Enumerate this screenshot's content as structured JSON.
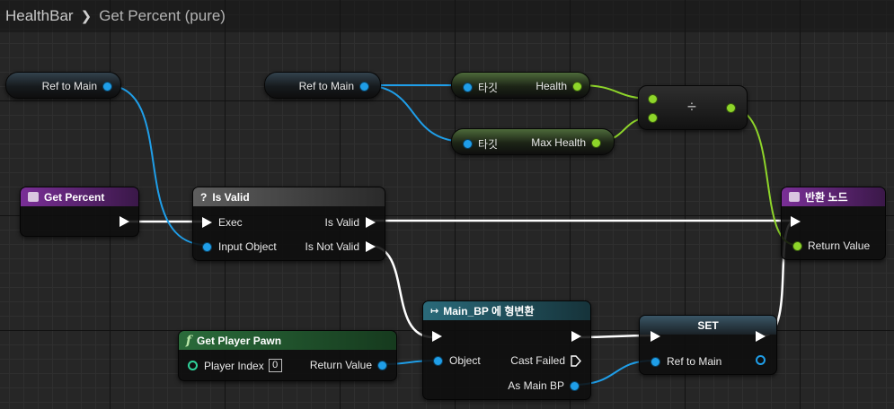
{
  "breadcrumb": {
    "blueprint": "HealthBar",
    "function": "Get Percent (pure)"
  },
  "nodes": {
    "ref_to_main_1": {
      "label": "Ref to Main"
    },
    "ref_to_main_2": {
      "label": "Ref to Main"
    },
    "target_health": {
      "target_label": "타깃",
      "output_label": "Health"
    },
    "target_max_health": {
      "target_label": "타깃",
      "output_label": "Max Health"
    },
    "divide": {
      "symbol": "÷"
    },
    "get_percent": {
      "title": "Get Percent"
    },
    "is_valid": {
      "title": "Is Valid",
      "icon": "?",
      "exec_in": "Exec",
      "input_object": "Input Object",
      "is_valid_out": "Is Valid",
      "is_not_valid_out": "Is Not Valid"
    },
    "return_node": {
      "title": "반환 노드",
      "return_value": "Return Value"
    },
    "cast": {
      "title": "Main_BP 에 형변환",
      "object": "Object",
      "cast_failed": "Cast Failed",
      "as_main_bp": "As Main BP"
    },
    "get_player_pawn": {
      "title": "Get Player Pawn",
      "icon": "f",
      "player_index_label": "Player Index",
      "player_index_value": "0",
      "return_value": "Return Value"
    },
    "set": {
      "title": "SET",
      "ref_to_main": "Ref to Main"
    }
  },
  "colors": {
    "exec_wire": "#ffffff",
    "object_wire": "#1f9ee8",
    "float_wire": "#8ed52a",
    "function_header": "#6c2a86",
    "pure_header": "#1e6b2e",
    "cast_header": "#1f4f5c"
  }
}
